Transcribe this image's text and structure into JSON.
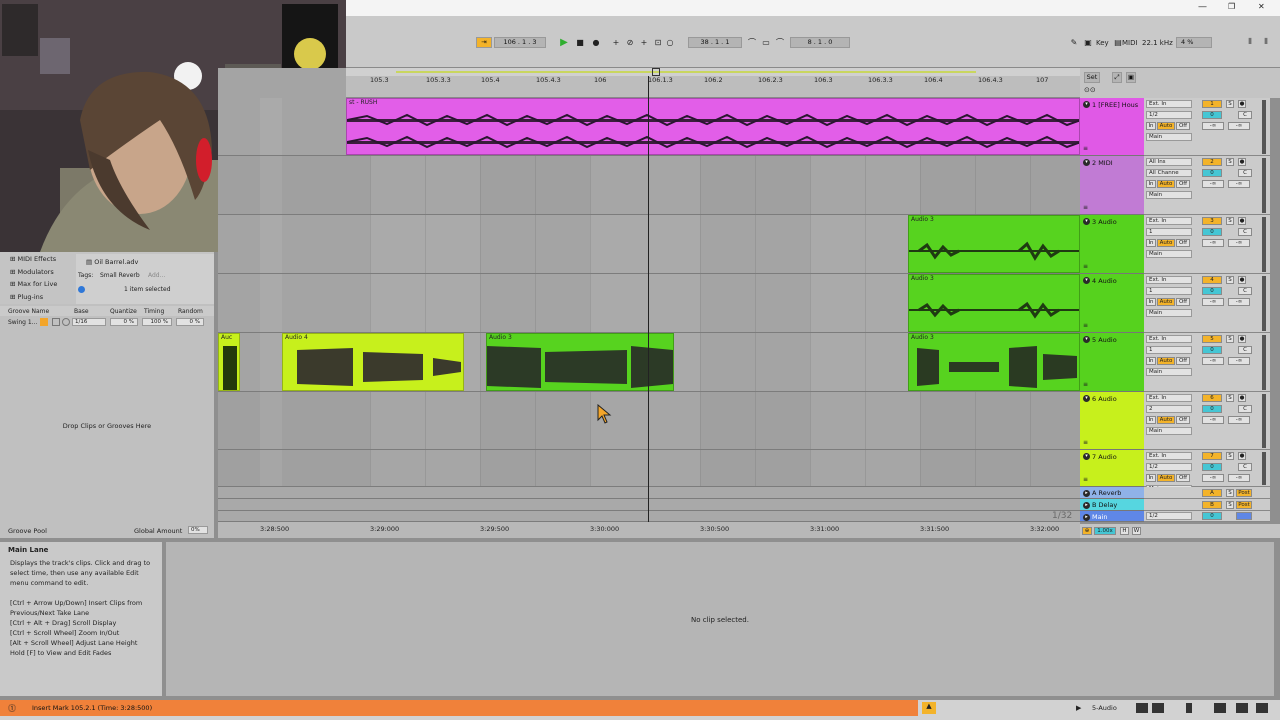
{
  "window": {
    "minimize": "—",
    "restore": "❐",
    "close": "✕"
  },
  "transport": {
    "position": "106 .  1 .  3",
    "loop_start": "38 .  1 .  1",
    "loop_length": "8 .  1 .  0",
    "key_label": "Key",
    "midi_label": "MIDI",
    "sample_rate": "22.1 kHz",
    "cpu": "4 %"
  },
  "ruler": {
    "bars": [
      "105.3",
      "105.3.3",
      "105.4",
      "105.4.3",
      "106",
      "106.1.3",
      "106.2",
      "106.2.3",
      "106.3",
      "106.3.3",
      "106.4",
      "106.4.3",
      "107"
    ],
    "set_label": "Set"
  },
  "time_ruler": {
    "labels": [
      "3:28:500",
      "3:29:000",
      "3:29:500",
      "3:30:000",
      "3:30:500",
      "3:31:000",
      "3:31:500",
      "3:32:000"
    ]
  },
  "zoom_hint": "1/32",
  "browser": {
    "items": [
      "MIDI Effects",
      "Modulators",
      "Max for Live",
      "Plug-ins"
    ],
    "file": "Oil Barrel.adv",
    "tags_label": "Tags:",
    "tag_value": "Small Reverb",
    "add_label": "Add...",
    "selected_count": "1 item selected"
  },
  "groove": {
    "headers": [
      "Groove Name",
      "Base",
      "Quantize",
      "Timing",
      "Random"
    ],
    "row": {
      "name": "Swing 1...",
      "base": "1/16",
      "quantize": "0 %",
      "timing": "100 %",
      "random": "0 %"
    },
    "drop_hint": "Drop Clips or Grooves Here",
    "pool_label": "Groove Pool",
    "global_amount_label": "Global Amount",
    "global_amount": "0%"
  },
  "clips": {
    "rush": "st - RUSH",
    "audio3_a": "Audio 3",
    "audio3_b": "Audio 3",
    "audio3_c": "Audio 3",
    "aud_small": "Auc",
    "audio4": "Audio 4",
    "audio3_d": "Audio 3"
  },
  "tracks": [
    {
      "name": "1 [FREE] Hous",
      "num": "1",
      "input": "Ext. In",
      "chan": "1/2",
      "out": "Main",
      "color": "#e059e6"
    },
    {
      "name": "2 MIDI",
      "num": "2",
      "input": "All Ins",
      "chan": "All Channe",
      "out": "Main",
      "color": "#c17bd4"
    },
    {
      "name": "3 Audio",
      "num": "3",
      "input": "Ext. In",
      "chan": "1",
      "out": "Main",
      "color": "#56d21e"
    },
    {
      "name": "4 Audio",
      "num": "4",
      "input": "Ext. In",
      "chan": "1",
      "out": "Main",
      "color": "#56d21e"
    },
    {
      "name": "5 Audio",
      "num": "5",
      "input": "Ext. In",
      "chan": "1",
      "out": "Main",
      "color": "#56d21e"
    },
    {
      "name": "6 Audio",
      "num": "6",
      "input": "Ext. In",
      "chan": "2",
      "out": "Main",
      "color": "#c7f01c"
    },
    {
      "name": "7 Audio",
      "num": "7",
      "input": "Ext. In",
      "chan": "1/2",
      "out": "Main",
      "color": "#c7f01c"
    }
  ],
  "mixer_labels": {
    "in": "In",
    "auto": "Auto",
    "off": "Off",
    "zero": "0",
    "center": "C",
    "inf": "-∞",
    "solo": "S"
  },
  "returns": [
    {
      "name": "A Reverb",
      "letter": "A",
      "post": "Post",
      "color": "#8fb2e8"
    },
    {
      "name": "B Delay",
      "letter": "B",
      "post": "Post",
      "color": "#56d6e0"
    }
  ],
  "main_track": {
    "name": "Main",
    "chan": "1/2",
    "zero": "0",
    "color": "#5f87e6"
  },
  "bottom_controls": {
    "zoom": "1.00x",
    "h": "H",
    "w": "W"
  },
  "info": {
    "title": "Main Lane",
    "body": "Displays the track's clips. Click and drag to select time, then use any available Edit menu command to edit.",
    "shortcuts": [
      "[Ctrl + Arrow Up/Down] Insert Clips from Previous/Next Take Lane",
      "[Ctrl + Alt + Drag] Scroll Display",
      "[Ctrl + Scroll Wheel] Zoom In/Out",
      "[Alt + Scroll Wheel] Adjust Lane Height",
      "Hold [F] to View and Edit Fades"
    ]
  },
  "detail": {
    "empty": "No clip selected."
  },
  "status": {
    "message": "Insert Mark 105.2.1 (Time: 3:28:500)",
    "track": "5-Audio"
  },
  "colors": {
    "accent_orange": "#f39a2b",
    "status_orange": "#f0813a",
    "playhead": "#222222"
  }
}
